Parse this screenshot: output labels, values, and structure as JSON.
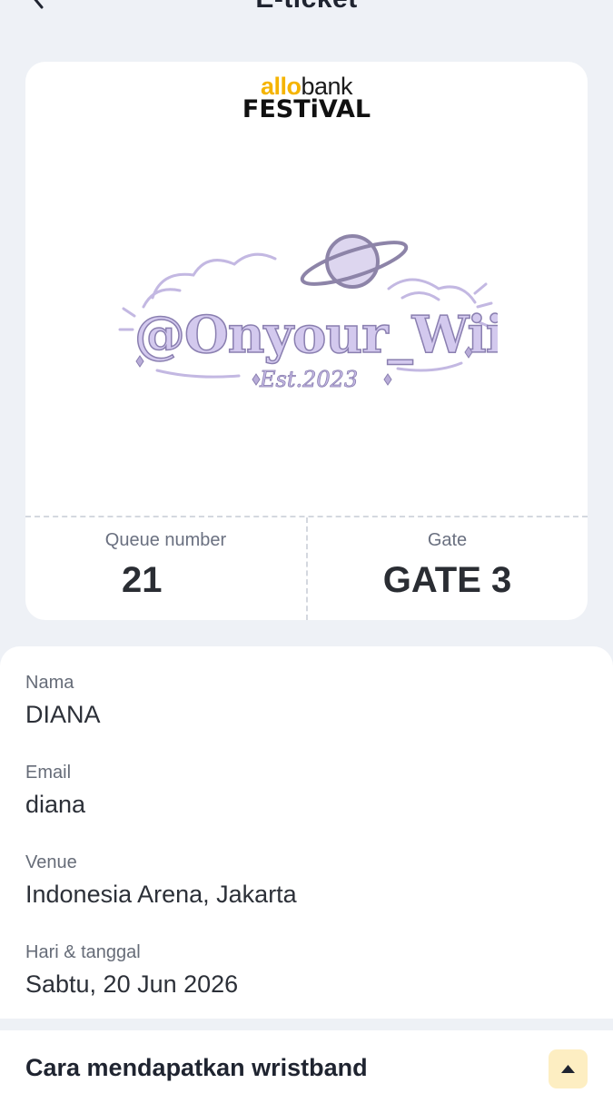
{
  "header": {
    "title": "E-ticket",
    "back_icon": "chevron-left-icon"
  },
  "ticket": {
    "brand": {
      "allo": "allo",
      "bank": "bank",
      "festival": "FESTiVAL",
      "colors": {
        "allo": "#f5b400",
        "text": "#111111"
      }
    },
    "artwork": {
      "handle": "@Onyour_Wiin",
      "est": "Est.2023",
      "color": "#b8acd8"
    },
    "queue": {
      "label": "Queue number",
      "value": "21"
    },
    "gate": {
      "label": "Gate",
      "value": "GATE 3"
    }
  },
  "details": {
    "fields": [
      {
        "label": "Nama",
        "value": "DIANA"
      },
      {
        "label": "Email",
        "value": "diana"
      },
      {
        "label": "Venue",
        "value": "Indonesia Arena, Jakarta"
      },
      {
        "label": "Hari & tanggal",
        "value": "Sabtu, 20 Jun 2026"
      }
    ]
  },
  "wristband": {
    "title": "Cara mendapatkan wristband",
    "toggle_icon": "caret-up-icon",
    "toggle_bg": "#fdeec2"
  }
}
